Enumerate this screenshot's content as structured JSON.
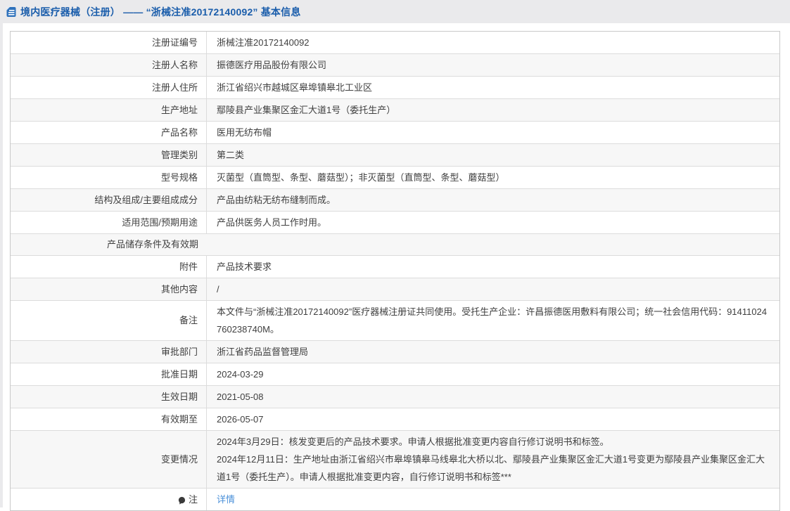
{
  "header": {
    "icon": "document-icon",
    "title": "境内医疗器械（注册） —— “浙械注准20172140092” 基本信息"
  },
  "colors": {
    "header_bg": "#eaeaec",
    "title_blue": "#1a5dab",
    "icon_blue": "#2f72bc",
    "link_blue": "#4a90d9",
    "row_alt_bg": "#f7f7f7",
    "border_outer": "#c9c9c9",
    "border_inner": "#dcdcdc",
    "text": "#404040"
  },
  "table": {
    "rows": [
      {
        "label": "注册证编号",
        "value": "浙械注准20172140092"
      },
      {
        "label": "注册人名称",
        "value": "振德医疗用品股份有限公司"
      },
      {
        "label": "注册人住所",
        "value": "浙江省绍兴市越城区皋埠镇皋北工业区"
      },
      {
        "label": "生产地址",
        "value": "鄢陵县产业集聚区金汇大道1号（委托生产）"
      },
      {
        "label": "产品名称",
        "value": "医用无纺布帽"
      },
      {
        "label": "管理类别",
        "value": "第二类"
      },
      {
        "label": "型号规格",
        "value": "灭菌型（直筒型、条型、蘑菇型）；非灭菌型（直筒型、条型、蘑菇型）"
      },
      {
        "label": "结构及组成/主要组成成分",
        "value": "产品由纺粘无纺布缝制而成。"
      },
      {
        "label": "适用范围/预期用途",
        "value": "产品供医务人员工作时用。"
      },
      {
        "label": "产品储存条件及有效期",
        "value": "",
        "divider": false
      },
      {
        "label": "附件",
        "value": "产品技术要求"
      },
      {
        "label": "其他内容",
        "value": "/"
      },
      {
        "label": "备注",
        "value": "本文件与“浙械注准20172140092”医疗器械注册证共同使用。受托生产企业：许昌振德医用敷料有限公司；统一社会信用代码：91411024760238740M。"
      },
      {
        "label": "审批部门",
        "value": "浙江省药品监督管理局"
      },
      {
        "label": "批准日期",
        "value": "2024-03-29"
      },
      {
        "label": "生效日期",
        "value": "2021-05-08"
      },
      {
        "label": "有效期至",
        "value": "2026-05-07"
      },
      {
        "label": "变更情况",
        "lines": [
          "2024年3月29日：核发变更后的产品技术要求。申请人根据批准变更内容自行修订说明书和标签。",
          "2024年12月11日：生产地址由浙江省绍兴市皋埠镇皋马线皋北大桥以北、鄢陵县产业集聚区金汇大道1号变更为鄢陵县产业集聚区金汇大道1号（委托生产）。申请人根据批准变更内容，自行修订说明书和标签***"
        ]
      },
      {
        "label": "注",
        "label_icon": "lightbulb-icon",
        "value": "详情",
        "link": true,
        "compact": true
      }
    ]
  }
}
